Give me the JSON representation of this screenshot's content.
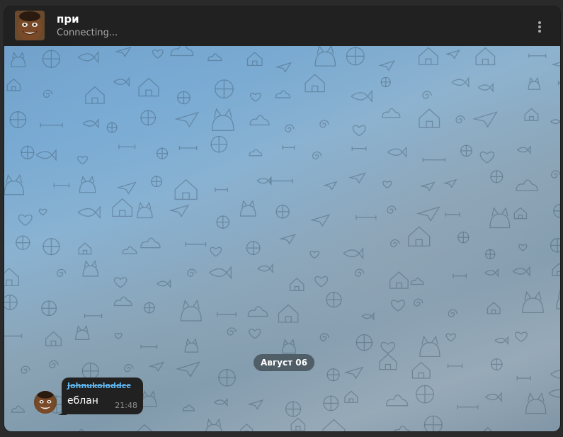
{
  "header": {
    "title": "при",
    "status": "Connecting..."
  },
  "chat": {
    "date_separator": "Август 06",
    "messages": [
      {
        "sender": "Johnukoloddcc",
        "text": "еблан",
        "time": "21:48"
      }
    ]
  },
  "colors": {
    "header_bg": "#212121",
    "bubble_bg": "#212121",
    "sender_name": "#5fb6ef",
    "wallpaper_tint": "#7aa8ce"
  },
  "icons": {
    "menu": "more-vertical-icon",
    "avatar": "user-avatar"
  }
}
